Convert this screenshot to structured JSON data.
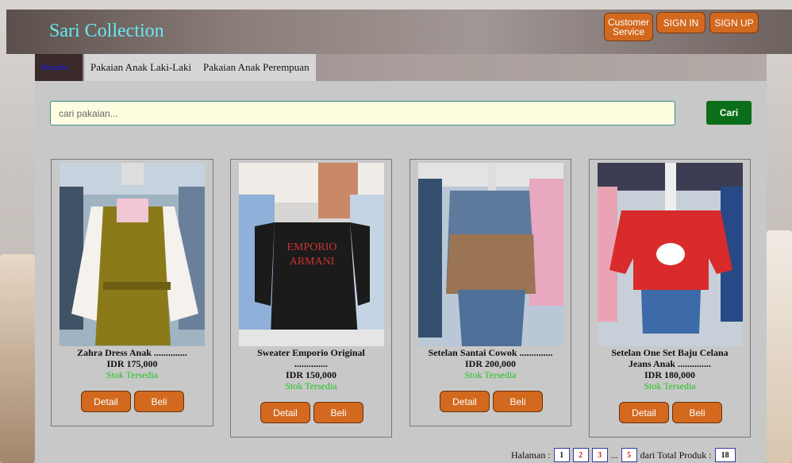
{
  "header": {
    "brand": "Sari Collection",
    "customer_service_label": "Customer Service",
    "signin_label": "SIGN IN",
    "signup_label": "SIGN UP"
  },
  "tabs": [
    {
      "label": "Beranda",
      "active": true
    },
    {
      "label": "Pakaian Anak Laki-Laki",
      "active": false
    },
    {
      "label": "Pakaian Anak Perempuan",
      "active": false
    }
  ],
  "search": {
    "placeholder": "cari pakaian...",
    "button_label": "Cari"
  },
  "products": [
    {
      "name": "Zahra Dress Anak ..............",
      "price": "IDR 175,000",
      "stock": "Stok Tersedia",
      "detail": "Detail",
      "buy": "Beli"
    },
    {
      "name": "Sweater Emporio Original ..............",
      "price": "IDR 150,000",
      "stock": "Stok Tersedia",
      "detail": "Detail",
      "buy": "Beli"
    },
    {
      "name": "Setelan Santai Cowok ..............",
      "price": "IDR 200,000",
      "stock": "Stok Tersedia",
      "detail": "Detail",
      "buy": "Beli"
    },
    {
      "name": "Setelan One Set Baju Celana Jeans Anak ..............",
      "price": "IDR 180,000",
      "stock": "Stok Tersedia",
      "detail": "Detail",
      "buy": "Beli"
    }
  ],
  "pagination": {
    "label": "Halaman :",
    "pages": [
      "1",
      "2",
      "3"
    ],
    "ellipsis": "...",
    "last_page": "5",
    "total_label": "dari Total Produk :",
    "total": "18"
  },
  "colors": {
    "accent": "#d2691e",
    "search_button": "#0b6e1a",
    "brand_text": "#67e8f0",
    "stock_text": "#22c422"
  }
}
